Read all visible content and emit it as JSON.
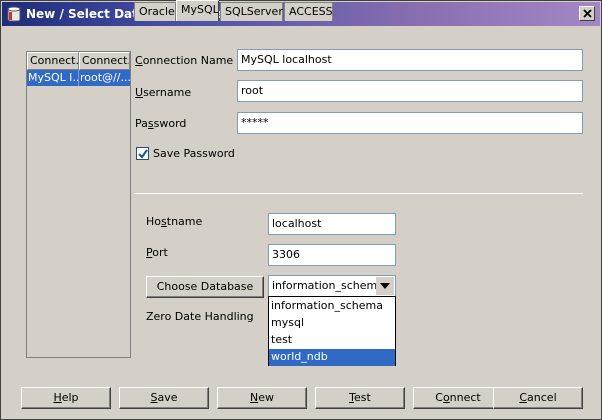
{
  "window": {
    "title": "New / Select Database Connection"
  },
  "connection_list": {
    "columns": [
      "Connect...",
      "Connect..."
    ],
    "rows": [
      {
        "name": "MySQL l...",
        "details": "root@//..."
      }
    ]
  },
  "form": {
    "connection_name_label": "Connection Name",
    "connection_name_value": "MySQL localhost",
    "username_label": "Username",
    "username_value": "root",
    "password_label": "Password",
    "password_value": "*****",
    "save_password_label": "Save Password",
    "save_password_checked": true
  },
  "tabs": [
    {
      "label": "Oracle"
    },
    {
      "label": "MySQL",
      "active": true
    },
    {
      "label": "SQLServer"
    },
    {
      "label": "ACCESS"
    }
  ],
  "mysql": {
    "hostname_label": "Hostname",
    "hostname_value": "localhost",
    "port_label": "Port",
    "port_value": "3306",
    "choose_db_label": "Choose Database",
    "selected_db": "information_schema",
    "db_options": [
      "information_schema",
      "mysql",
      "test",
      "world_ndb"
    ],
    "highlighted_option": "world_ndb",
    "zero_date_label": "Zero Date Handling"
  },
  "buttons": {
    "help": "Help",
    "save": "Save",
    "new": "New",
    "test": "Test",
    "connect": "Connect",
    "cancel": "Cancel"
  },
  "colors": {
    "selection": "#316ac5",
    "dialog_bg": "#d4d0c8",
    "title_start": "#1d2d7a",
    "title_end": "#a487c4"
  }
}
